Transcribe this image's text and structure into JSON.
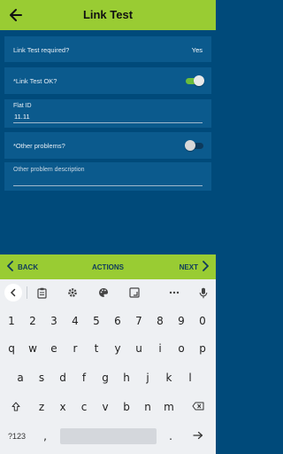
{
  "header": {
    "title": "Link Test",
    "back_icon": "arrow-left-icon",
    "bg_color": "#99cc33"
  },
  "form": {
    "link_test_required": {
      "label": "Link Test required?",
      "value": "Yes"
    },
    "link_test_ok": {
      "label": "*Link Test OK?",
      "checked": true
    },
    "flat_id": {
      "label": "Flat ID",
      "value": "11.11"
    },
    "other_problems": {
      "label": "*Other problems?",
      "checked": false
    },
    "other_problem_description": {
      "placeholder": "Other problem description",
      "value": ""
    }
  },
  "footer": {
    "back_label": "BACK",
    "actions_label": "ACTIONS",
    "next_label": "NEXT"
  },
  "keyboard": {
    "toolbar_icons": [
      "collapse-icon",
      "clipboard-icon",
      "settings-icon",
      "palette-icon",
      "resize-icon",
      "more-icon",
      "microphone-icon"
    ],
    "row_numbers": [
      "1",
      "2",
      "3",
      "4",
      "5",
      "6",
      "7",
      "8",
      "9",
      "0"
    ],
    "row_top": [
      "q",
      "w",
      "e",
      "r",
      "t",
      "y",
      "u",
      "i",
      "o",
      "p"
    ],
    "row_middle": [
      "a",
      "s",
      "d",
      "f",
      "g",
      "h",
      "j",
      "k",
      "l"
    ],
    "row_bottom": [
      "z",
      "x",
      "c",
      "v",
      "b",
      "n",
      "m"
    ],
    "symbols_label": "?123",
    "comma_label": ",",
    "period_label": "."
  },
  "colors": {
    "page_bg": "#004a7a",
    "row_bg": "#0b5a8d",
    "accent_green": "#99cc33",
    "toggle_on": "#6bbd3c",
    "footer_text": "#0f3a5c"
  }
}
